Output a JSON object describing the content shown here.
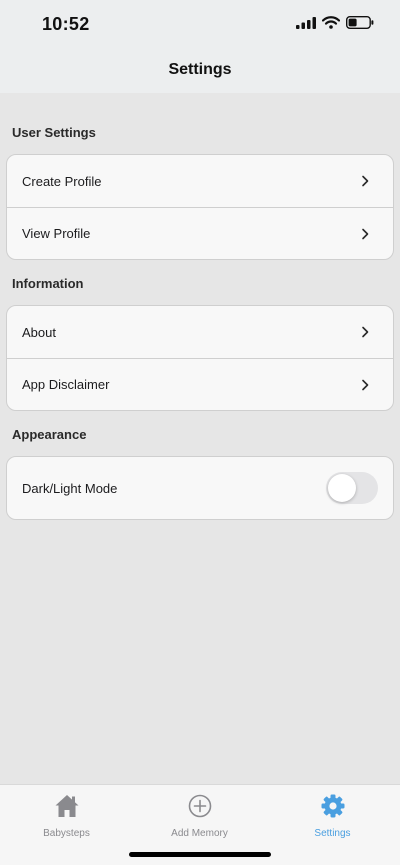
{
  "status_bar": {
    "time": "10:52"
  },
  "header": {
    "title": "Settings"
  },
  "sections": {
    "user_settings": {
      "title": "User Settings",
      "items": [
        {
          "label": "Create Profile"
        },
        {
          "label": "View Profile"
        }
      ]
    },
    "information": {
      "title": "Information",
      "items": [
        {
          "label": "About"
        },
        {
          "label": "App Disclaimer"
        }
      ]
    },
    "appearance": {
      "title": "Appearance",
      "toggle": {
        "label": "Dark/Light Mode",
        "on": false
      }
    }
  },
  "tab_bar": {
    "tabs": [
      {
        "label": "Babysteps",
        "icon": "home-icon",
        "active": false
      },
      {
        "label": "Add Memory",
        "icon": "add-circle-icon",
        "active": false
      },
      {
        "label": "Settings",
        "icon": "gear-icon",
        "active": true
      }
    ]
  },
  "colors": {
    "accent": "#4a9fe0",
    "inactive": "#8a8a8e",
    "background": "#e6e6e6",
    "card": "#f8f8f8"
  }
}
